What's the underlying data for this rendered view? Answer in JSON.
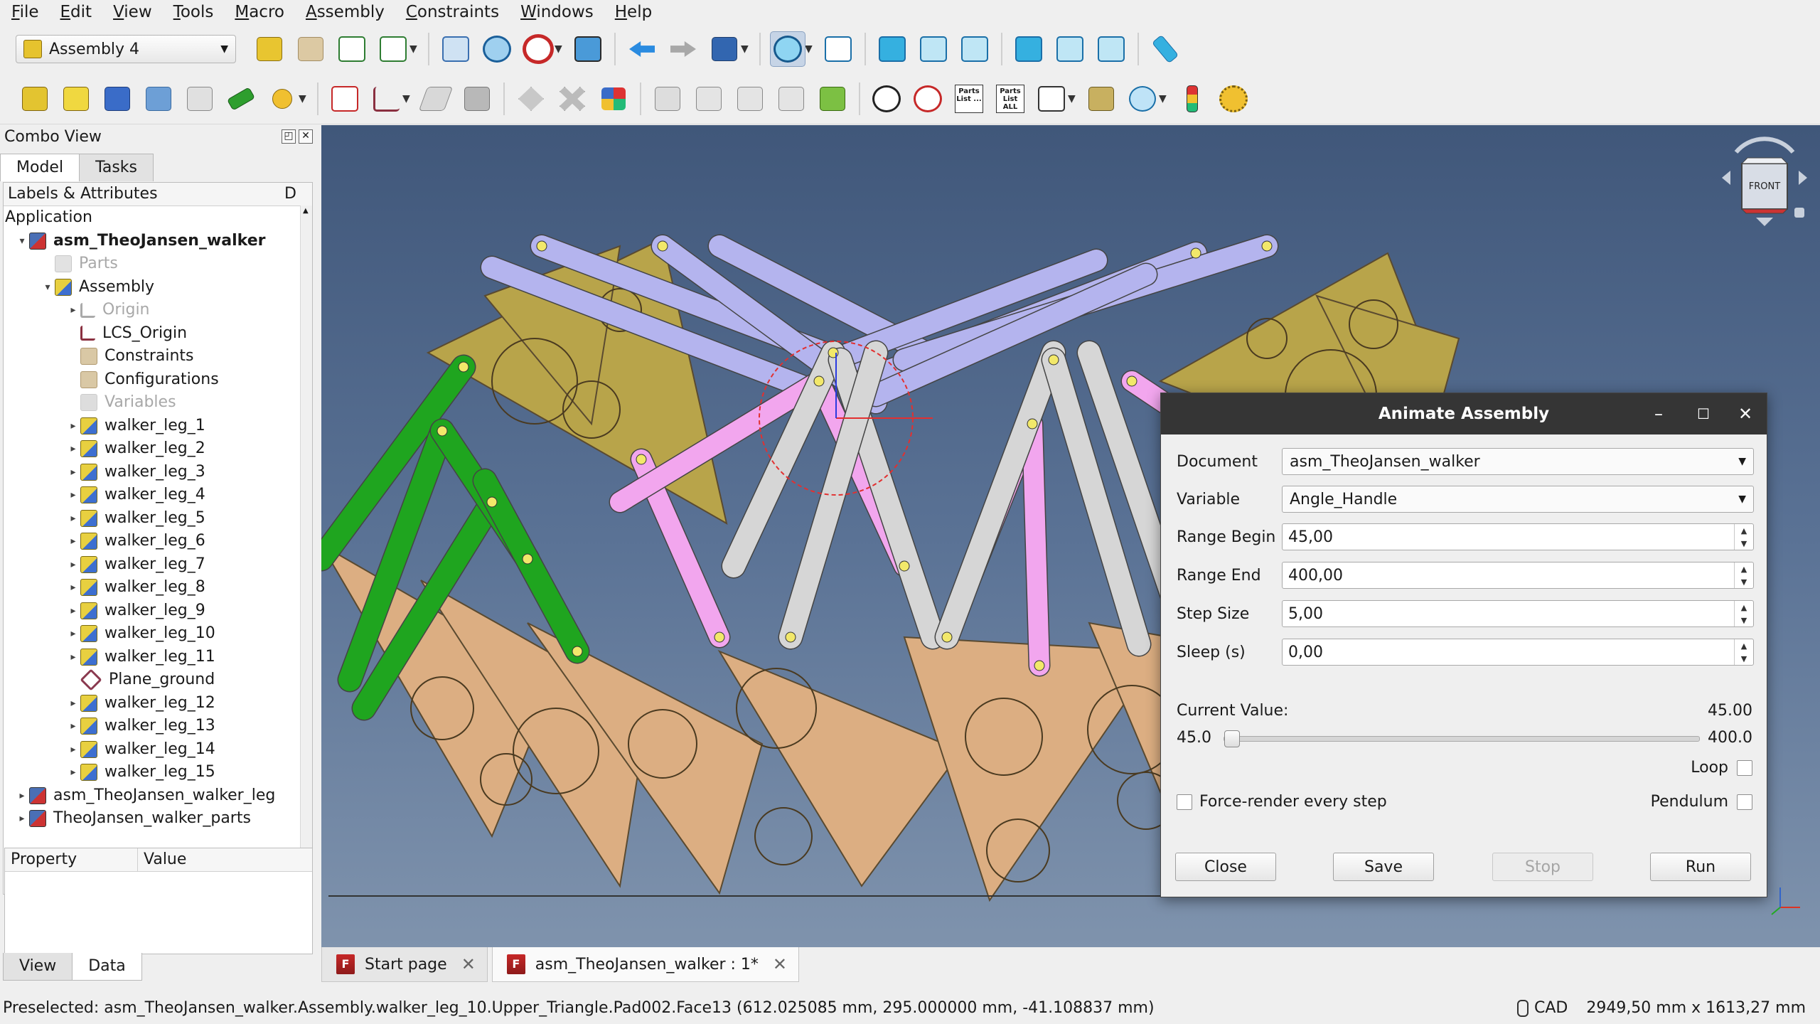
{
  "menu": [
    "File",
    "Edit",
    "View",
    "Tools",
    "Macro",
    "Assembly",
    "Constraints",
    "Windows",
    "Help"
  ],
  "workbench": {
    "selected": "Assembly 4"
  },
  "toolbar": {
    "parts_list": "Parts List ...",
    "parts_list_all": "Parts List ALL"
  },
  "combo": {
    "title": "Combo View",
    "tabs": [
      "Model",
      "Tasks"
    ],
    "tree_header": "Labels & Attributes",
    "tree_header_extra": "D",
    "tree": [
      {
        "label": "Application",
        "indent": 0,
        "arrow": "",
        "icon": "",
        "style": ""
      },
      {
        "label": "asm_TheoJansen_walker",
        "indent": 1,
        "arrow": "▾",
        "icon": "doc",
        "style": "bold"
      },
      {
        "label": "Parts",
        "indent": 2,
        "arrow": "",
        "icon": "greyfolder",
        "style": "grey"
      },
      {
        "label": "Assembly",
        "indent": 2,
        "arrow": "▾",
        "icon": "part",
        "style": ""
      },
      {
        "label": "Origin",
        "indent": 3,
        "arrow": "▸",
        "icon": "lcs-grey",
        "style": "grey"
      },
      {
        "label": "LCS_Origin",
        "indent": 3,
        "arrow": "",
        "icon": "lcs",
        "style": ""
      },
      {
        "label": "Constraints",
        "indent": 3,
        "arrow": "",
        "icon": "folder",
        "style": ""
      },
      {
        "label": "Configurations",
        "indent": 3,
        "arrow": "",
        "icon": "folder",
        "style": ""
      },
      {
        "label": "Variables",
        "indent": 3,
        "arrow": "",
        "icon": "var",
        "style": "grey"
      },
      {
        "label": "walker_leg_1",
        "indent": 3,
        "arrow": "▸",
        "icon": "part",
        "style": ""
      },
      {
        "label": "walker_leg_2",
        "indent": 3,
        "arrow": "▸",
        "icon": "part",
        "style": ""
      },
      {
        "label": "walker_leg_3",
        "indent": 3,
        "arrow": "▸",
        "icon": "part",
        "style": ""
      },
      {
        "label": "walker_leg_4",
        "indent": 3,
        "arrow": "▸",
        "icon": "part",
        "style": ""
      },
      {
        "label": "walker_leg_5",
        "indent": 3,
        "arrow": "▸",
        "icon": "part",
        "style": ""
      },
      {
        "label": "walker_leg_6",
        "indent": 3,
        "arrow": "▸",
        "icon": "part",
        "style": ""
      },
      {
        "label": "walker_leg_7",
        "indent": 3,
        "arrow": "▸",
        "icon": "part",
        "style": ""
      },
      {
        "label": "walker_leg_8",
        "indent": 3,
        "arrow": "▸",
        "icon": "part",
        "style": ""
      },
      {
        "label": "walker_leg_9",
        "indent": 3,
        "arrow": "▸",
        "icon": "part",
        "style": ""
      },
      {
        "label": "walker_leg_10",
        "indent": 3,
        "arrow": "▸",
        "icon": "part",
        "style": ""
      },
      {
        "label": "walker_leg_11",
        "indent": 3,
        "arrow": "▸",
        "icon": "part",
        "style": ""
      },
      {
        "label": "Plane_ground",
        "indent": 3,
        "arrow": "",
        "icon": "plane",
        "style": ""
      },
      {
        "label": "walker_leg_12",
        "indent": 3,
        "arrow": "▸",
        "icon": "part",
        "style": ""
      },
      {
        "label": "walker_leg_13",
        "indent": 3,
        "arrow": "▸",
        "icon": "part",
        "style": ""
      },
      {
        "label": "walker_leg_14",
        "indent": 3,
        "arrow": "▸",
        "icon": "part",
        "style": ""
      },
      {
        "label": "walker_leg_15",
        "indent": 3,
        "arrow": "▸",
        "icon": "part",
        "style": ""
      },
      {
        "label": "asm_TheoJansen_walker_leg",
        "indent": 1,
        "arrow": "▸",
        "icon": "doc",
        "style": ""
      },
      {
        "label": "TheoJansen_walker_parts",
        "indent": 1,
        "arrow": "▸",
        "icon": "doc",
        "style": ""
      }
    ],
    "property_headers": [
      "Property",
      "Value"
    ],
    "bottom_tabs": [
      "View",
      "Data"
    ]
  },
  "navcube": {
    "face": "FRONT"
  },
  "doc_tabs": [
    {
      "label": "Start page",
      "active": false
    },
    {
      "label": "asm_TheoJansen_walker : 1*",
      "active": true
    }
  ],
  "status": {
    "preselected": "Preselected: asm_TheoJansen_walker.Assembly.walker_leg_10.Upper_Triangle.Pad002.Face13 (612.025085 mm, 295.000000 mm, -41.108837 mm)",
    "nav_style": "CAD",
    "dimensions": "2949,50 mm x 1613,27 mm"
  },
  "dialog": {
    "title": "Animate Assembly",
    "document_label": "Document",
    "document_value": "asm_TheoJansen_walker",
    "variable_label": "Variable",
    "variable_value": "Angle_Handle",
    "range_begin_label": "Range Begin",
    "range_begin_value": "45,00",
    "range_end_label": "Range End",
    "range_end_value": "400,00",
    "step_size_label": "Step Size",
    "step_size_value": "5,00",
    "sleep_label": "Sleep (s)",
    "sleep_value": "0,00",
    "current_value_label": "Current Value:",
    "current_value": "45.00",
    "slider_min": "45.0",
    "slider_max": "400.0",
    "slider_fraction": 0.0,
    "loop_label": "Loop",
    "loop_checked": false,
    "force_render_label": "Force-render every step",
    "force_render_checked": false,
    "pendulum_label": "Pendulum",
    "pendulum_checked": false,
    "buttons": {
      "close": "Close",
      "save": "Save",
      "stop": "Stop",
      "run": "Run"
    }
  },
  "colors": {
    "viewport_top": "#40577a",
    "viewport_bottom": "#7f93ad",
    "tan": "#dcae82",
    "olive": "#b8a44a",
    "lavender": "#b4b4ee",
    "green": "#1fa51f",
    "pink": "#f2a6ee",
    "grey_link": "#d6d6d6"
  }
}
